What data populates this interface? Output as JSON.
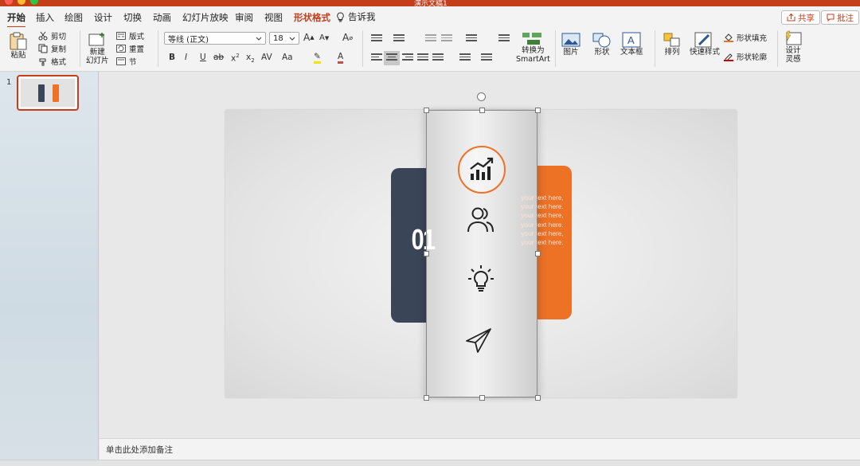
{
  "window": {
    "title": "演示文稿1",
    "traffic_colors": [
      "#ff5f57",
      "#febc2e",
      "#28c840"
    ]
  },
  "tabs": [
    "开始",
    "插入",
    "绘图",
    "设计",
    "切换",
    "动画",
    "幻灯片放映",
    "审阅",
    "视图",
    "形状格式"
  ],
  "active_tab": "开始",
  "tell_me": "告诉我",
  "share": {
    "label": "共享",
    "icon": "share-icon"
  },
  "comments": {
    "label": "批注",
    "icon": "comment-icon"
  },
  "ribbon": {
    "paste": "粘贴",
    "cut": "剪切",
    "copy": "复制",
    "format_painter": "格式",
    "new_slide": "新建\n幻灯片",
    "layout": "版式",
    "reset": "重置",
    "section": "节",
    "font_name": "等线 (正文)",
    "font_size": "18",
    "convert_smartart": "转换为\nSmartArt",
    "picture": "图片",
    "shape": "形状",
    "textbox": "文本框",
    "arrange": "排列",
    "quick_styles": "快速样式",
    "shape_fill": "形状填充",
    "shape_outline": "形状轮廓",
    "design_ideas": "设计\n灵感"
  },
  "thumbnail": {
    "number": "1"
  },
  "notes_placeholder": "单击此处添加备注",
  "slide": {
    "number_label": "01",
    "body_text": "your text here, your text here. your text here, your text here. your text here, your text here.",
    "colors": {
      "dark": "#3a4557",
      "accent": "#ed7226"
    },
    "icons": [
      "growth-chart-icon",
      "people-icon",
      "lightbulb-icon",
      "paper-plane-icon"
    ]
  }
}
